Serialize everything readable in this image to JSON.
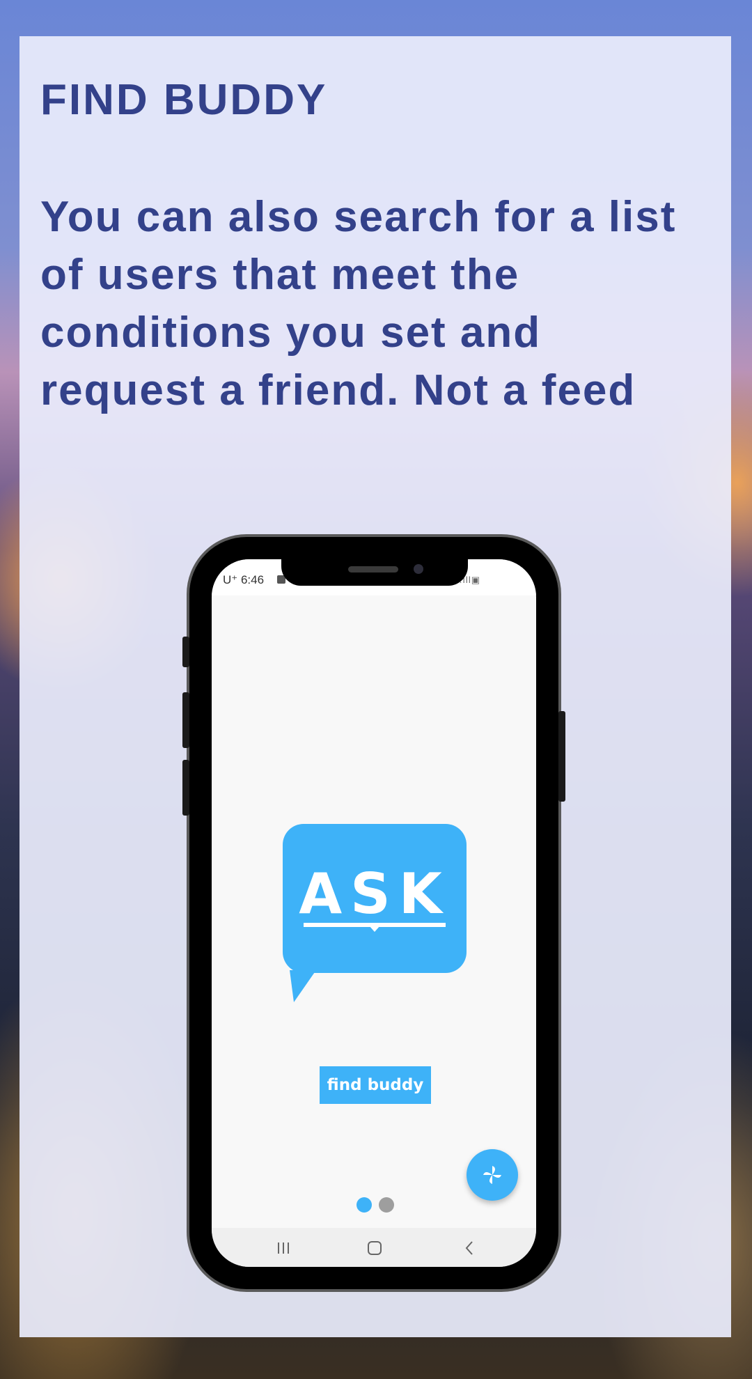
{
  "heading": "FIND BUDDY",
  "description": "You can also search for a list of users that meet the conditions you set and request a friend. Not a feed",
  "phone": {
    "status_bar": {
      "carrier_time": "U⁺ 6:46",
      "right_icons": "▾.ıll▣"
    },
    "logo": {
      "text": "ASK",
      "color": "#3eb2f8"
    },
    "find_label": "find buddy",
    "fab_icon": "pinwheel-icon",
    "page_indicator": {
      "pages": 2,
      "active": 1,
      "active_color": "#3eb2f8",
      "inactive_color": "#9e9e9e"
    },
    "nav_bar": {
      "recent_icon": "recent-apps-icon",
      "home_icon": "home-icon",
      "back_icon": "back-icon"
    }
  }
}
